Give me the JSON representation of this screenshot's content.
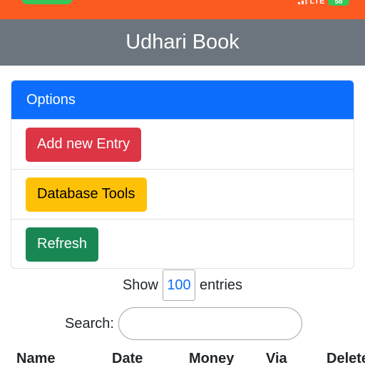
{
  "status_bar": {
    "network": "LTE",
    "battery": "58"
  },
  "header": {
    "title": "Udhari Book"
  },
  "options": {
    "title": "Options",
    "add_label": "Add new Entry",
    "database_label": "Database Tools",
    "refresh_label": "Refresh"
  },
  "table_controls": {
    "show_prefix": "Show",
    "page_length": "100",
    "show_suffix": "entries",
    "search_label": "Search:",
    "search_value": ""
  },
  "table": {
    "columns": [
      "Name",
      "Date",
      "Money",
      "Via",
      "Delete"
    ]
  },
  "colors": {
    "status_bar": "#fd5a22",
    "header": "#6c757d",
    "primary": "#0d6efd",
    "danger": "#dc3545",
    "warning": "#ffc107",
    "success": "#198754"
  }
}
